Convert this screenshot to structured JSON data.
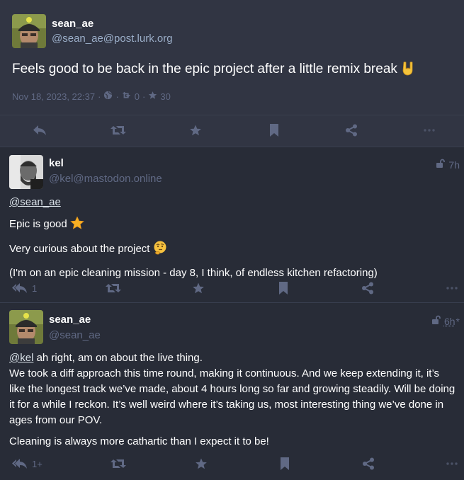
{
  "focused": {
    "display_name": "sean_ae",
    "acct": "@sean_ae@post.lurk.org",
    "text": "Feels good to be back in the epic project after a little remix break",
    "timestamp": "Nov 18, 2023, 22:37",
    "separator": "·",
    "boosts": "0",
    "favourites": "30"
  },
  "reply1": {
    "display_name": "kel",
    "acct": "@kel@mastodon.online",
    "time": "7h",
    "mention": "@sean_ae",
    "line1": "Epic is good",
    "line2": "Very curious about the project",
    "line3": "(I'm on an epic cleaning mission - day 8, I think, of endless kitchen refactoring)",
    "reply_count": "1"
  },
  "reply2": {
    "display_name": "sean_ae",
    "acct": "@sean_ae",
    "time": "6h",
    "edited_marker": "*",
    "mention": "@kel",
    "p1_rest": " ah right, am on about the live thing.",
    "p1_line2": "We took a diff approach this time round, making it continuous. And we keep extending it, it’s like the longest track we’ve made, about 4 hours long so far and growing steadily. Will be doing it for a while I reckon. It’s well weird where it’s taking us, most interesting thing we’ve done in ages from our POV.",
    "p2": "Cleaning is always more cathartic than I expect it to be!",
    "reply_count": "1+"
  },
  "colors": {
    "background": "#282c37",
    "focused_background": "#313543",
    "icon": "#606984",
    "secondary_text": "#9baec8"
  }
}
